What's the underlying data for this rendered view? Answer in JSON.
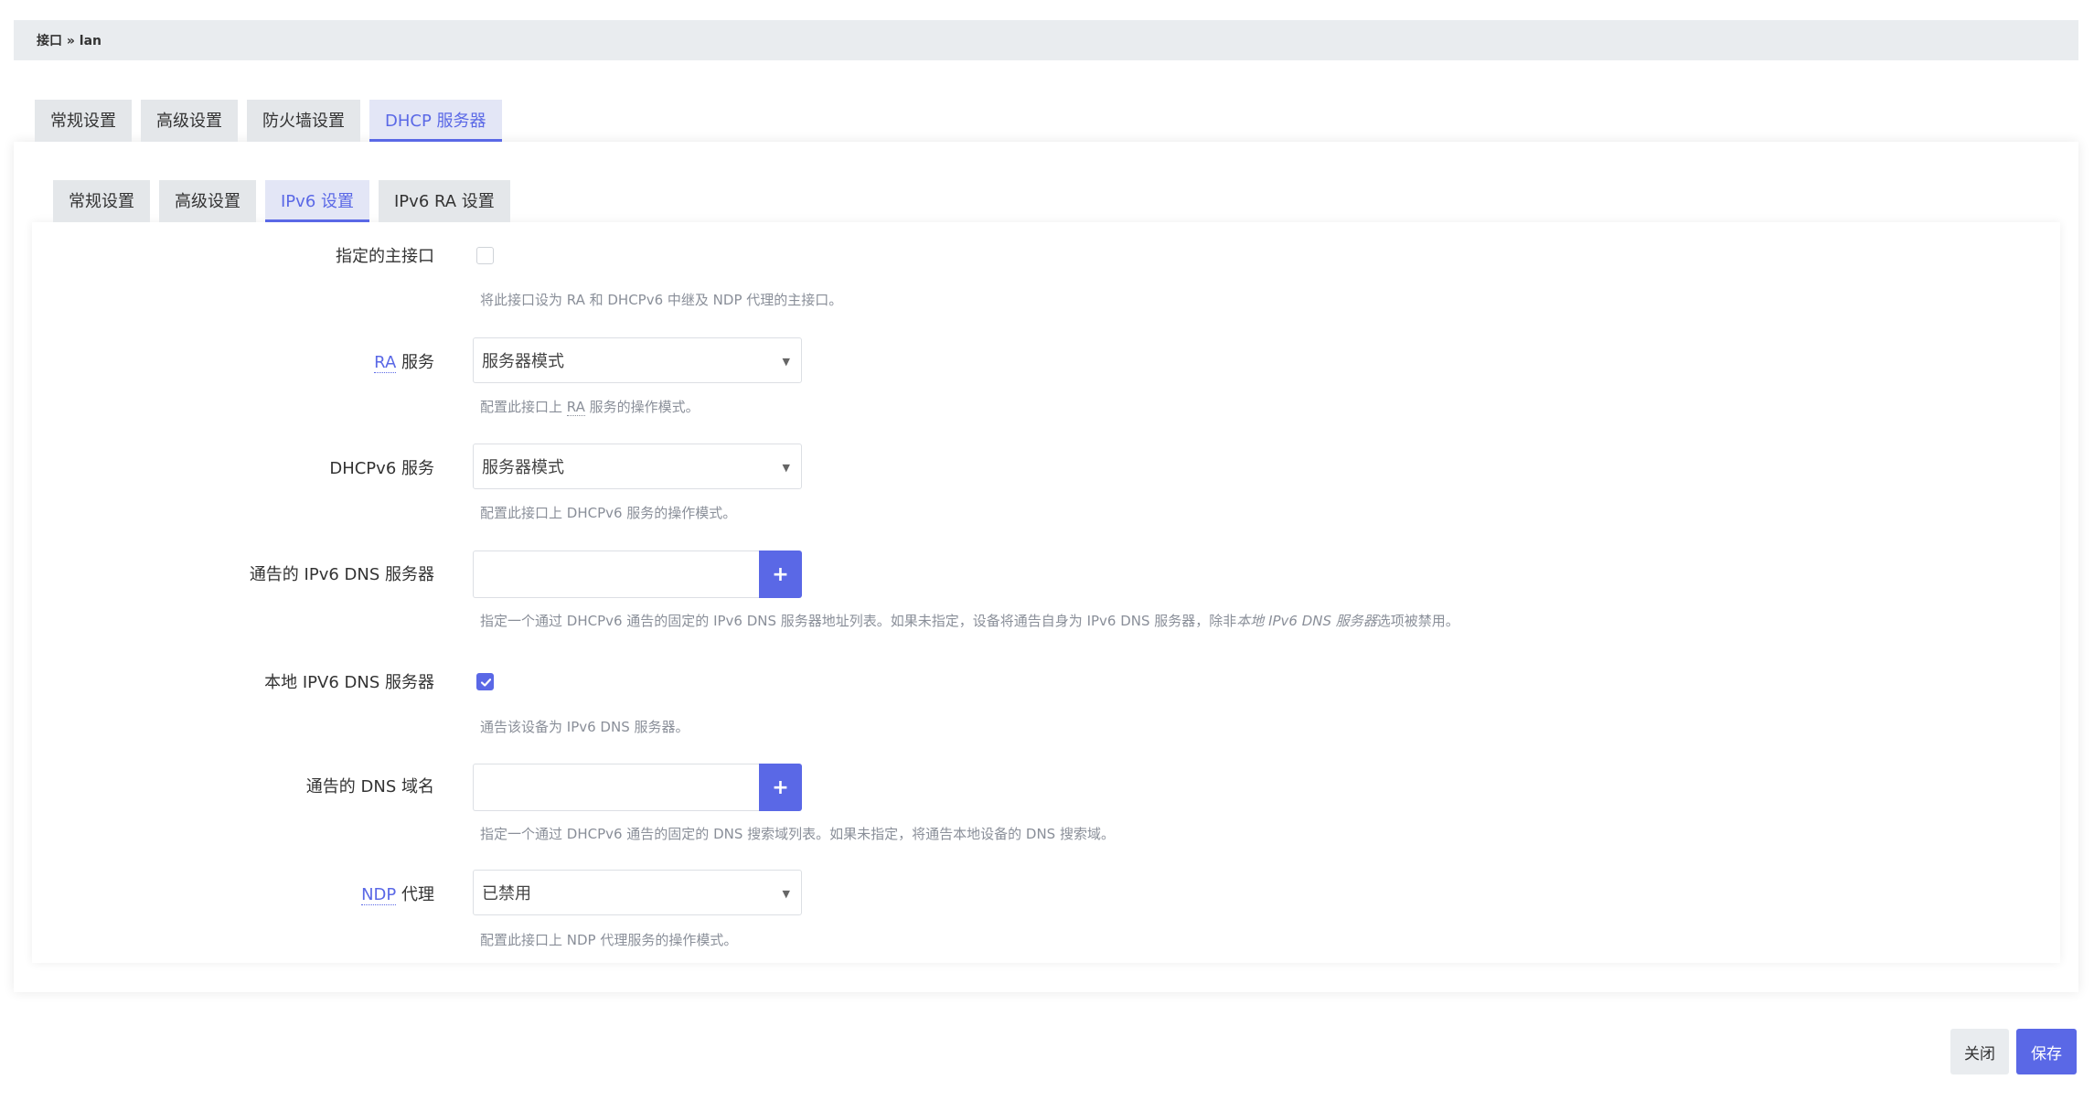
{
  "breadcrumb": "接口 » lan",
  "outer_tabs": [
    "常规设置",
    "高级设置",
    "防火墙设置",
    "DHCP 服务器"
  ],
  "inner_tabs": [
    "常规设置",
    "高级设置",
    "IPv6 设置",
    "IPv6 RA 设置"
  ],
  "active_outer_tab": "DHCP 服务器",
  "active_inner_tab": "IPv6 设置",
  "fields": {
    "master_interface": {
      "label": "指定的主接口",
      "checked": false,
      "help": "将此接口设为 RA 和 DHCPv6 中继及 NDP 代理的主接口。"
    },
    "ra_service": {
      "label_abbr": "RA",
      "label_rest": " 服务",
      "value": "服务器模式",
      "help_pre": "配置此接口上 ",
      "help_abbr": "RA",
      "help_post": " 服务的操作模式。"
    },
    "dhcpv6_service": {
      "label": "DHCPv6 服务",
      "value": "服务器模式",
      "help": "配置此接口上 DHCPv6 服务的操作模式。"
    },
    "announced_dns": {
      "label": "通告的 IPv6 DNS 服务器",
      "add_label": "+",
      "help_pre": "指定一个通过 DHCPv6 通告的固定的 IPv6 DNS 服务器地址列表。如果未指定，设备将通告自身为 IPv6 DNS 服务器，除非",
      "help_em": "本地 IPv6 DNS 服务器",
      "help_post": "选项被禁用。"
    },
    "local_dns": {
      "label": "本地 IPV6 DNS 服务器",
      "checked": true,
      "help": "通告该设备为 IPv6 DNS 服务器。"
    },
    "announced_domains": {
      "label": "通告的 DNS 域名",
      "add_label": "+",
      "help": "指定一个通过 DHCPv6 通告的固定的 DNS 搜索域列表。如果未指定，将通告本地设备的 DNS 搜索域。"
    },
    "ndp_proxy": {
      "label_abbr": "NDP",
      "label_rest": " 代理",
      "value": "已禁用",
      "help": "配置此接口上 NDP 代理服务的操作模式。"
    }
  },
  "buttons": {
    "close": "关闭",
    "save": "保存"
  },
  "colors": {
    "accent": "#5a68e6",
    "tab_bg": "#e4e7ea",
    "help_text": "#8a8f99"
  },
  "icons": {
    "select_caret": "triangle-down",
    "checkbox_check": "checkmark",
    "add": "plus"
  }
}
